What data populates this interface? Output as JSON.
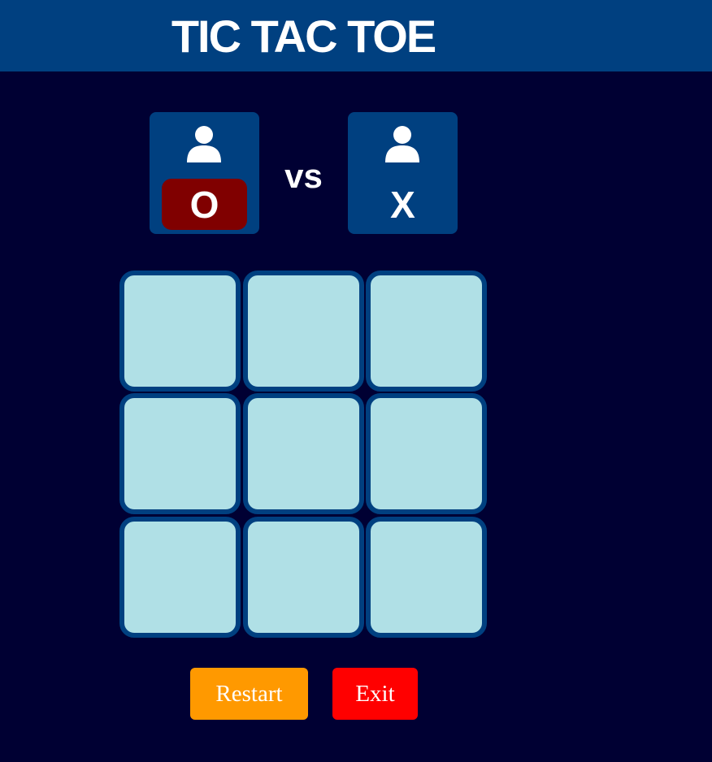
{
  "header": {
    "title": "TIC TAC TOE"
  },
  "players": [
    {
      "icon": "user-icon",
      "symbol": "O",
      "active": true
    },
    {
      "icon": "user-icon",
      "symbol": "X",
      "active": false
    }
  ],
  "vs_label": "vs",
  "board": {
    "cells": [
      "",
      "",
      "",
      "",
      "",
      "",
      "",
      "",
      ""
    ]
  },
  "buttons": {
    "restart": "Restart",
    "exit": "Exit"
  },
  "colors": {
    "background": "#000033",
    "header": "#004080",
    "card": "#004080",
    "active_symbol": "#800000",
    "cell": "#b0e0e6",
    "cell_border": "#004080",
    "restart": "#ff9900",
    "exit": "#ff0000"
  }
}
